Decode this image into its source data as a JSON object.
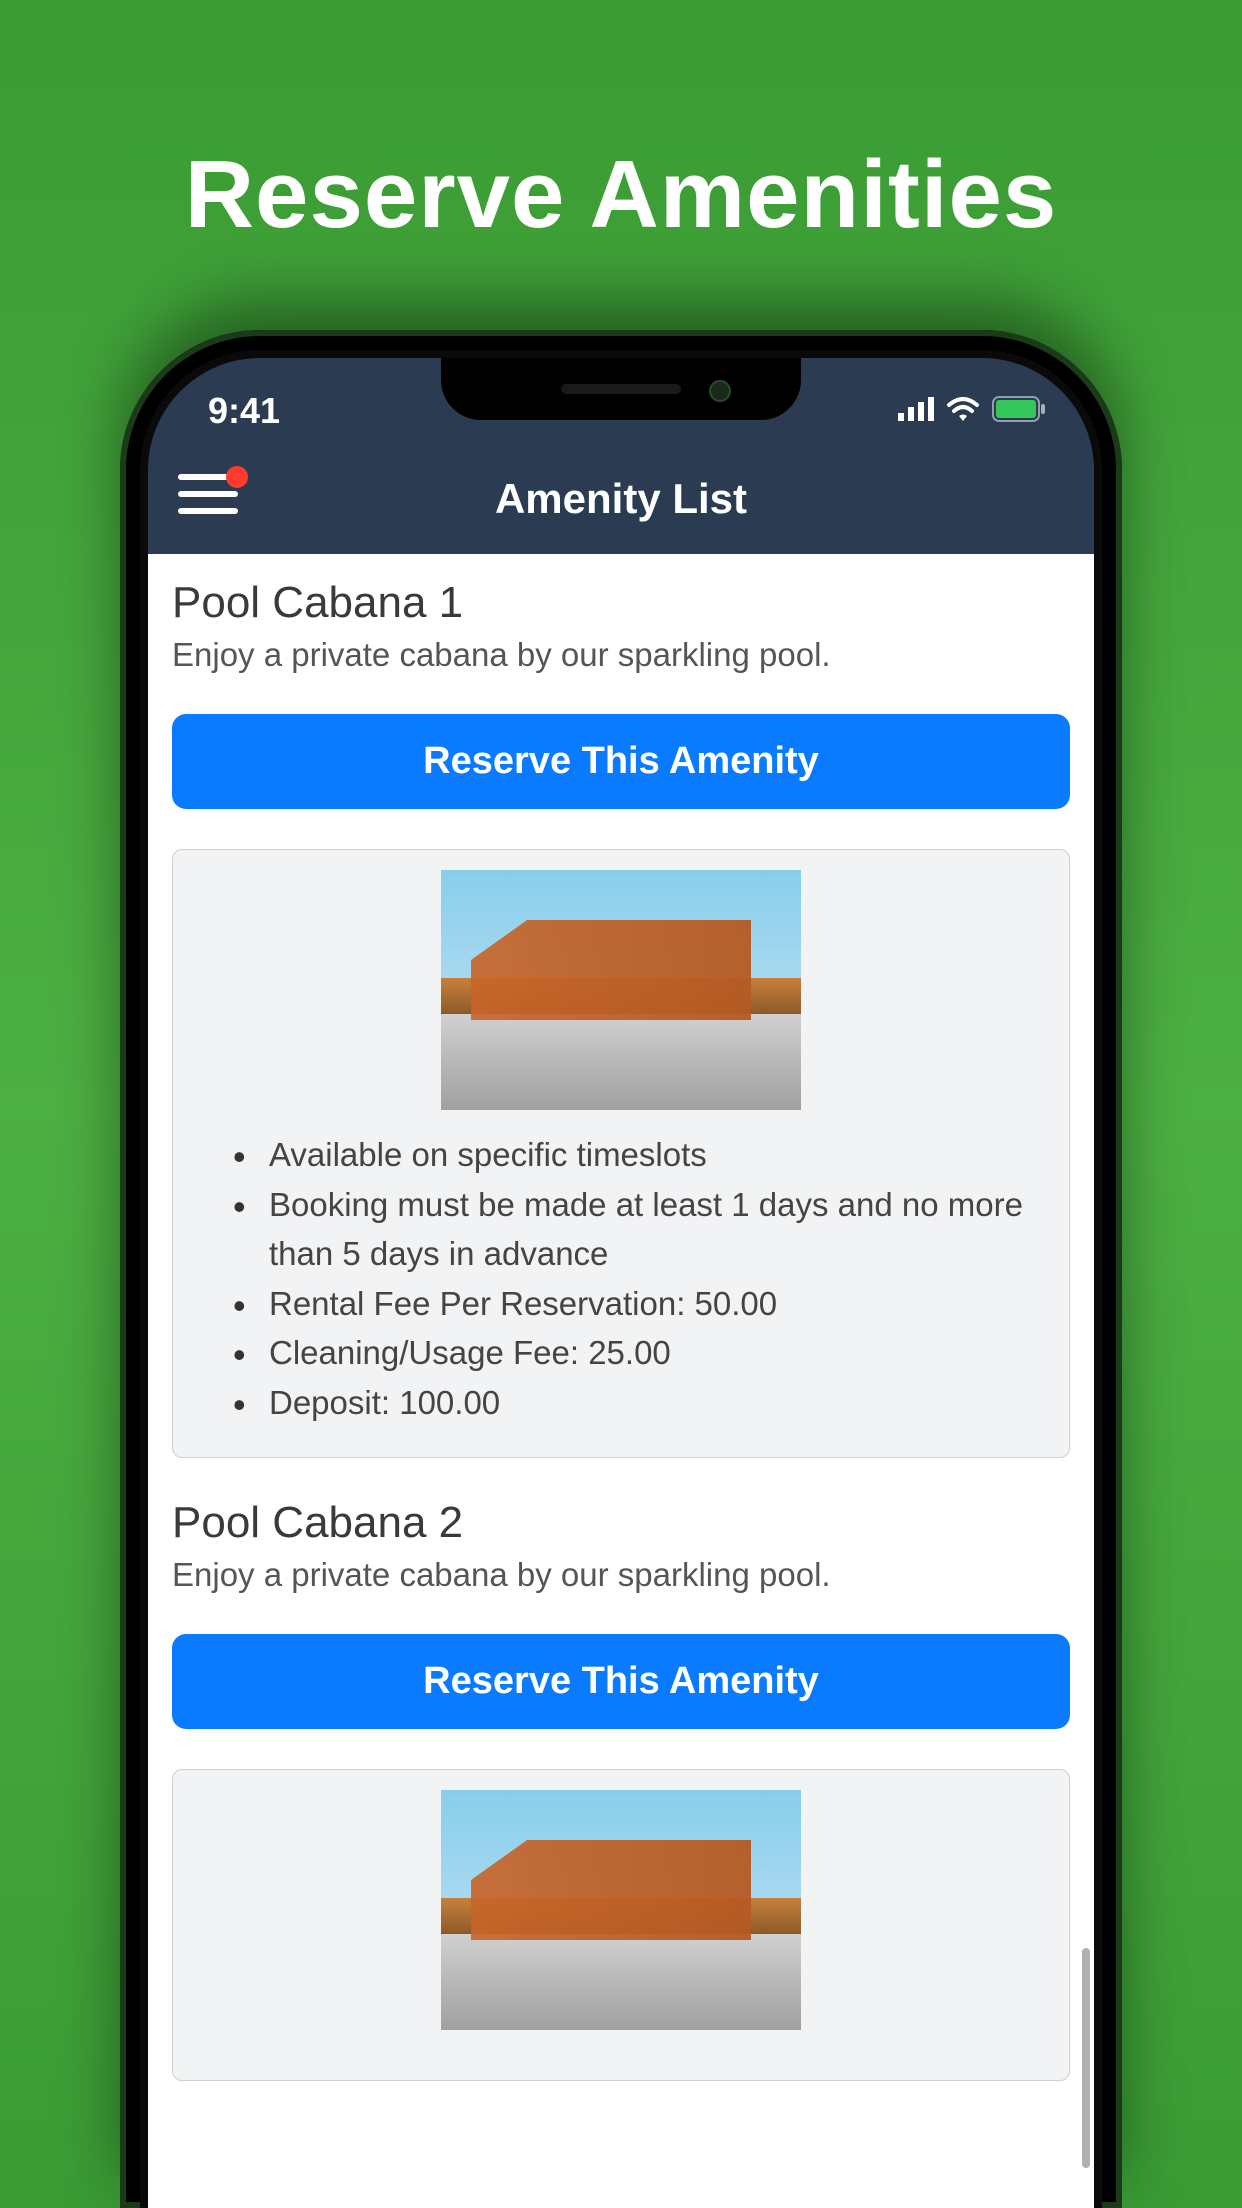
{
  "page": {
    "title": "Reserve Amenities"
  },
  "status_bar": {
    "time": "9:41"
  },
  "header": {
    "title": "Amenity List"
  },
  "reserve_button_label": "Reserve This Amenity",
  "amenities": [
    {
      "title": "Pool Cabana 1",
      "description": "Enjoy a private cabana by our sparkling pool.",
      "details": [
        "Available on specific timeslots",
        "Booking must be made at least 1 days and no more than 5 days in advance",
        "Rental Fee Per Reservation: 50.00",
        "Cleaning/Usage Fee: 25.00",
        "Deposit: 100.00"
      ]
    },
    {
      "title": "Pool Cabana 2",
      "description": "Enjoy a private cabana by our sparkling pool.",
      "details": []
    }
  ]
}
